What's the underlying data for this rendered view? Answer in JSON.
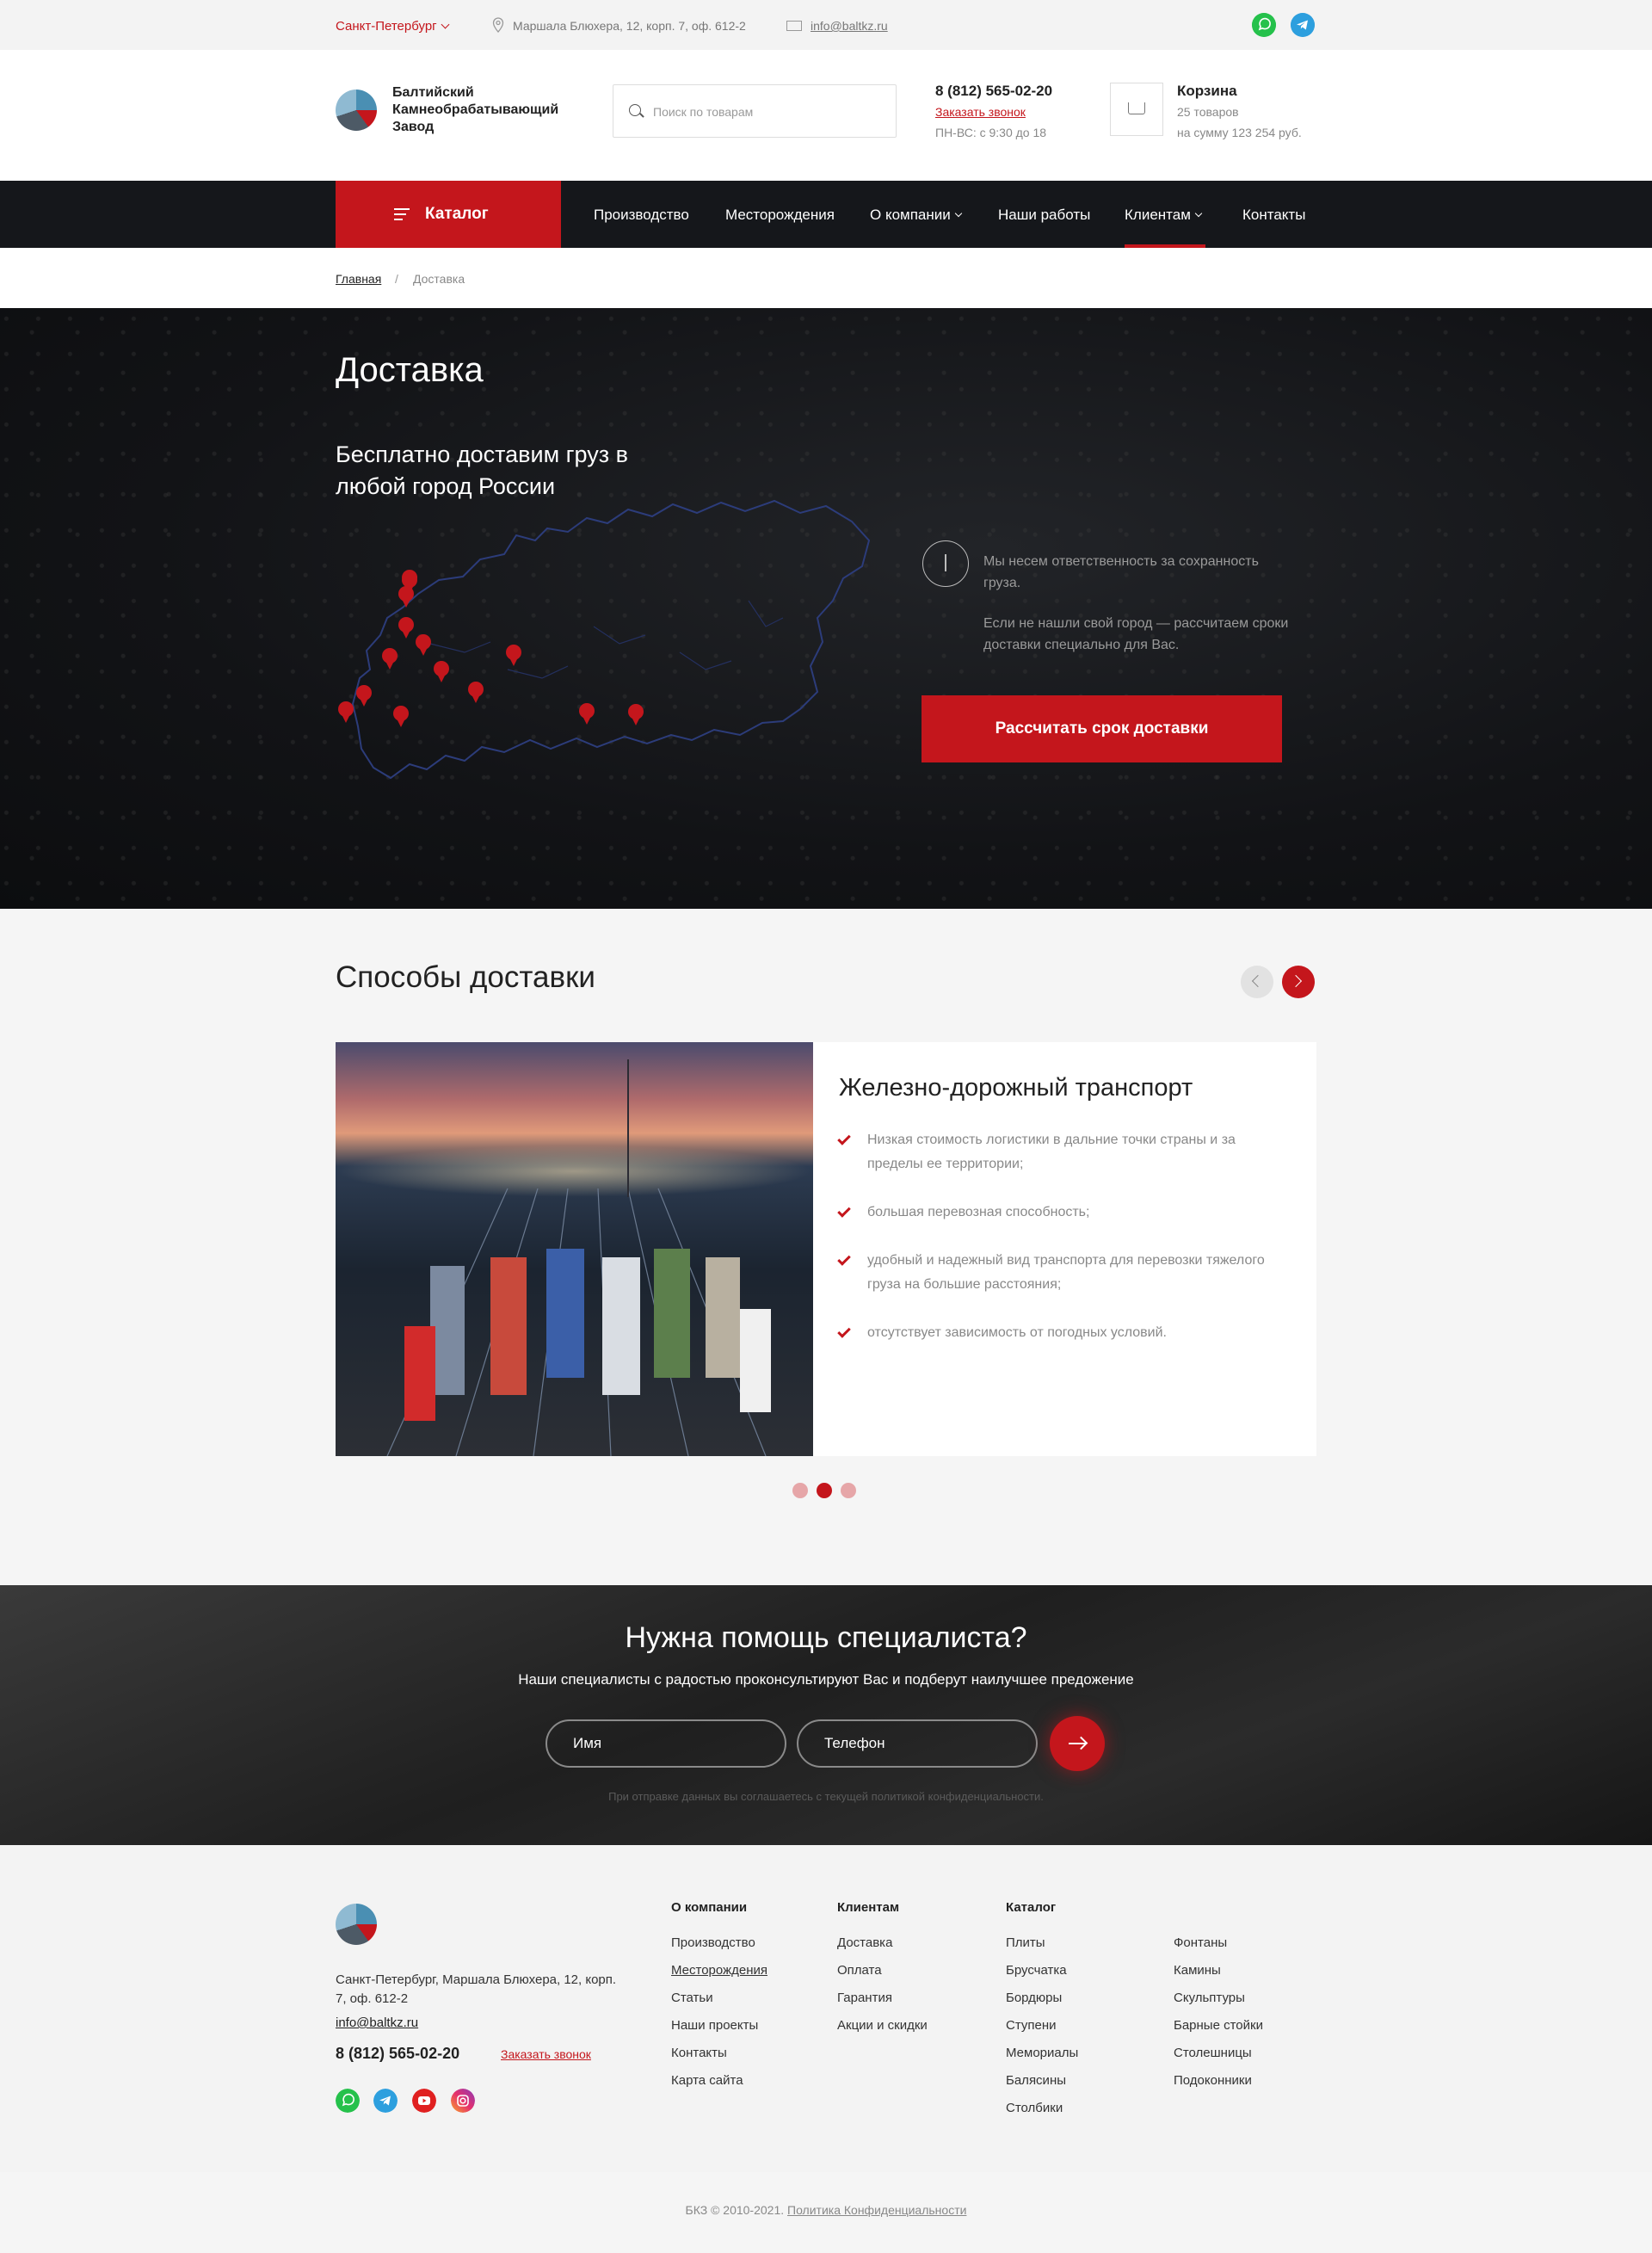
{
  "topbar": {
    "city": "Санкт-Петербург",
    "address": "Маршала Блюхера, 12, корп. 7, оф. 612-2",
    "email": "info@baltkz.ru",
    "socials": [
      "whatsapp-icon",
      "telegram-icon"
    ]
  },
  "header": {
    "logo_text": "Балтийский Камнеобрабатывающий Завод",
    "search_placeholder": "Поиск по товарам",
    "phone": "8 (812) 565-02-20",
    "callback": "Заказать звонок",
    "hours": "ПН-ВС: с 9:30 до 18",
    "cart_title": "Корзина",
    "cart_count": "25 товаров",
    "cart_sum": "на сумму  123 254 руб."
  },
  "nav": {
    "catalog": "Каталог",
    "items": [
      {
        "label": "Производство"
      },
      {
        "label": "Месторождения"
      },
      {
        "label": "О компании"
      },
      {
        "label": "Наши работы"
      },
      {
        "label": "Клиентам"
      },
      {
        "label": "Контакты"
      }
    ],
    "active": "Клиентам"
  },
  "breadcrumb": {
    "home": "Главная",
    "separator": "/",
    "current": "Доставка"
  },
  "hero": {
    "title": "Доставка",
    "lead": "Бесплатно доставим груз в любой город России",
    "note1": "Мы несем ответственность за сохранность груза.",
    "note2": "Если не нашли свой город — рассчитаем сроки доставки специально для Вас.",
    "button": "Рассчитать срок доставки"
  },
  "methods": {
    "title": "Способы доставки",
    "card_title": "Железно-дорожный транспорт",
    "features": [
      "Низкая стоимость логистики в дальние точки страны и за пределы ее территории;",
      "большая перевозная способность;",
      "удобный и надежный вид транспорта для перевозки тяжелого груза на большие расстояния;",
      "отсутствует зависимость от погодных условий."
    ],
    "active_slide": 2,
    "slide_count": 3
  },
  "help": {
    "title": "Нужна помощь специалиста?",
    "subtitle": "Наши специалисты с радостью проконсультируют Вас и подберут наилучшее предожение",
    "name_placeholder": "Имя",
    "phone_placeholder": "Телефон",
    "privacy": "При отправке данных вы соглашаетесь с текущей политикой конфиденциальности."
  },
  "footer": {
    "address": "Санкт-Петербург, Маршала Блюхера, 12, корп. 7, оф. 612-2",
    "email": "info@baltkz.ru",
    "phone": "8 (812) 565-02-20",
    "callback": "Заказать звонок",
    "columns": [
      {
        "title": "О компании",
        "items": [
          "Производство",
          "Месторождения",
          "Статьи",
          "Наши проекты",
          "Контакты",
          "Карта сайта"
        ]
      },
      {
        "title": "Клиентам",
        "items": [
          "Доставка",
          "Оплата",
          "Гарантия",
          "Акции и скидки"
        ]
      },
      {
        "title": "Каталог",
        "items": [
          "Плиты",
          "Брусчатка",
          "Бордюры",
          "Ступени",
          "Мемориалы",
          "Балясины",
          "Столбики"
        ]
      },
      {
        "title": "",
        "items": [
          "Фонтаны",
          "Камины",
          "Скульптуры",
          "Барные стойки",
          "Столешницы",
          "Подоконники"
        ]
      }
    ],
    "socials": [
      "whatsapp-icon",
      "telegram-icon",
      "youtube-icon",
      "instagram-icon"
    ],
    "copyright": "БКЗ © 2010-2021.",
    "policy": "Политика Конфиденциальности"
  },
  "colors": {
    "accent": "#c4161c",
    "nav_bg": "#15171b"
  }
}
